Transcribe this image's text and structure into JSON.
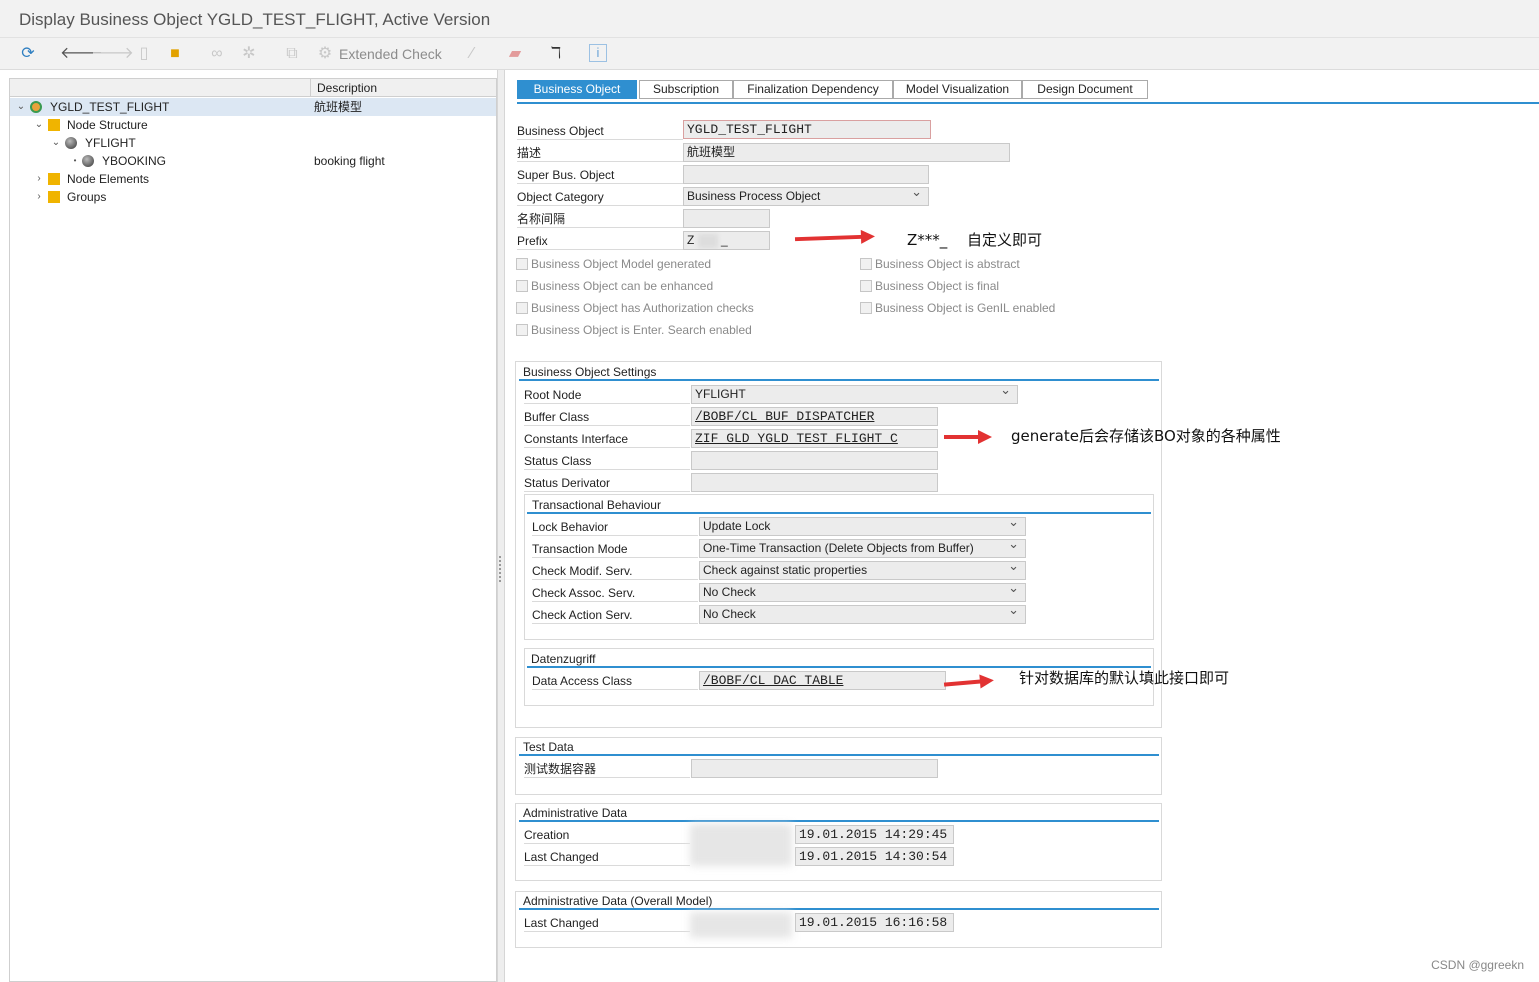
{
  "window": {
    "title": "Display Business Object YGLD_TEST_FLIGHT, Active Version"
  },
  "toolbar": {
    "extended_check": "Extended Check"
  },
  "tree": {
    "col_description": "Description",
    "nodes": [
      {
        "label": "YGLD_TEST_FLIGHT",
        "desc": "航班模型"
      },
      {
        "label": "Node Structure",
        "desc": ""
      },
      {
        "label": "YFLIGHT",
        "desc": ""
      },
      {
        "label": "YBOOKING",
        "desc": "booking flight"
      },
      {
        "label": "Node Elements",
        "desc": ""
      },
      {
        "label": "Groups",
        "desc": ""
      }
    ]
  },
  "tabs": [
    "Business Object",
    "Subscription",
    "Finalization Dependency",
    "Model Visualization",
    "Design Document"
  ],
  "bo": {
    "labels": [
      "Business Object",
      "描述",
      "Super Bus. Object",
      "Object Category",
      "名称间隔",
      "Prefix"
    ],
    "business_object": "YGLD_TEST_FLIGHT",
    "description": "航班模型",
    "super_bo": "",
    "object_category": "Business Process Object",
    "namespace": "",
    "prefix": "Z",
    "prefix_suffix": "_"
  },
  "checkboxes": {
    "left": [
      "Business Object Model generated",
      "Business Object can be enhanced",
      "Business Object has Authorization checks",
      "Business Object is Enter. Search enabled"
    ],
    "right": [
      "Business Object is abstract",
      "Business Object is final",
      "Business Object is GenIL enabled"
    ]
  },
  "settings": {
    "title": "Business Object Settings",
    "labels": [
      "Root Node",
      "Buffer Class",
      "Constants Interface",
      "Status Class",
      "Status Derivator"
    ],
    "root_node": "YFLIGHT",
    "buffer_class": "/BOBF/CL_BUF_DISPATCHER",
    "constants_interface": "ZIF_GLD_YGLD_TEST_FLIGHT_C",
    "status_class": "",
    "status_derivator": ""
  },
  "transactional": {
    "title": "Transactional Behaviour",
    "labels": [
      "Lock Behavior",
      "Transaction Mode",
      "Check Modif. Serv.",
      "Check Assoc. Serv.",
      "Check Action Serv."
    ],
    "values": [
      "Update Lock",
      "One-Time Transaction (Delete Objects from Buffer)",
      "Check against static properties",
      "No Check",
      "No Check"
    ]
  },
  "datenzugriff": {
    "title": "Datenzugriff",
    "label": "Data Access Class",
    "value": "/BOBF/CL_DAC_TABLE"
  },
  "test_data": {
    "title": "Test Data",
    "label": "测试数据容器",
    "value": ""
  },
  "admin": {
    "title": "Administrative Data",
    "creation_label": "Creation",
    "creation": "19.01.2015 14:29:45",
    "changed_label": "Last Changed",
    "changed": "19.01.2015 14:30:54"
  },
  "admin_overall": {
    "title": "Administrative Data (Overall Model)",
    "changed_label": "Last Changed",
    "changed": "19.01.2015 16:16:58"
  },
  "annotations": {
    "prefix_note": "Z***_　 自定义即可",
    "constants_note": "generate后会存储该BO对象的各种属性",
    "dac_note": "针对数据库的默认填此接口即可"
  },
  "watermark": "CSDN @ggreekn"
}
